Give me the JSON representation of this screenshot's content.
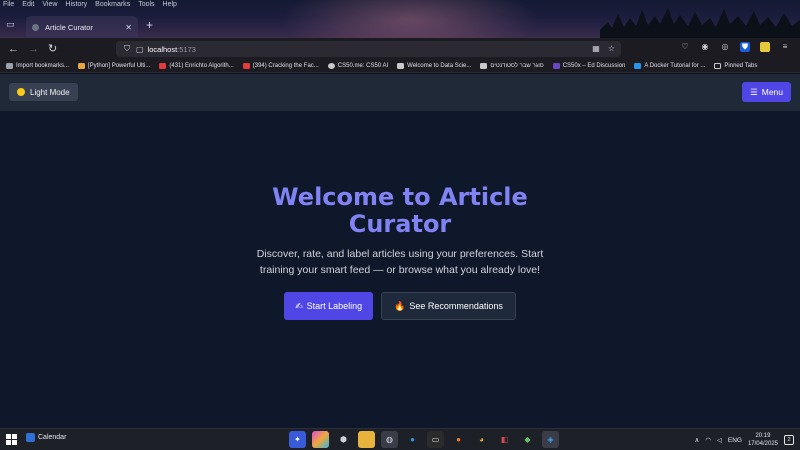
{
  "browser": {
    "menu": [
      "File",
      "Edit",
      "View",
      "History",
      "Bookmarks",
      "Tools",
      "Help"
    ],
    "tab_title": "Article Curator",
    "url_host": "localhost",
    "url_port": ":5173",
    "bookmarks": [
      {
        "label": "Import bookmarks...",
        "color": "#9aa0ad"
      },
      {
        "label": "[Python] Powerful Ulti...",
        "color": "#e9a43b"
      },
      {
        "label": "(431) Enrichto Algorith...",
        "color": "#e23b3b"
      },
      {
        "label": "(394) Cracking the Fac...",
        "color": "#e23b3b"
      },
      {
        "label": "CS50.me: CS50 AI",
        "color": "#c9c9c9"
      },
      {
        "label": "Welcome to Data Scie...",
        "color": "#c9c9c9"
      },
      {
        "label": "סוגר שבר לסטודנטים",
        "color": "#c9c9c9"
      },
      {
        "label": "CS50x – Ed Discussion",
        "color": "#6b46c1"
      },
      {
        "label": "A Docker Tutorial for ...",
        "color": "#2496ed"
      },
      {
        "label": "Pinned Tabs",
        "color": "#c9c9c9"
      }
    ]
  },
  "app": {
    "light_mode_label": "Light Mode",
    "menu_label": "Menu",
    "menu_icon": "☰",
    "hero_title": "Welcome to Article Curator",
    "hero_subtitle": "Discover, rate, and label articles using your preferences. Start training your smart feed — or browse what you already love!",
    "start_labeling_icon": "✍",
    "start_labeling_label": "Start Labeling",
    "recommendations_icon": "🔥",
    "recommendations_label": "See Recommendations"
  },
  "taskbar": {
    "widget_label": "Calendar",
    "language": "ENG",
    "time": "20:19",
    "date": "17/04/2025",
    "notifications": "2"
  },
  "colors": {
    "accent": "#4f46e5",
    "hero_title": "#8183f4",
    "app_bg": "#0f172a",
    "header_bg": "#1f2937"
  }
}
